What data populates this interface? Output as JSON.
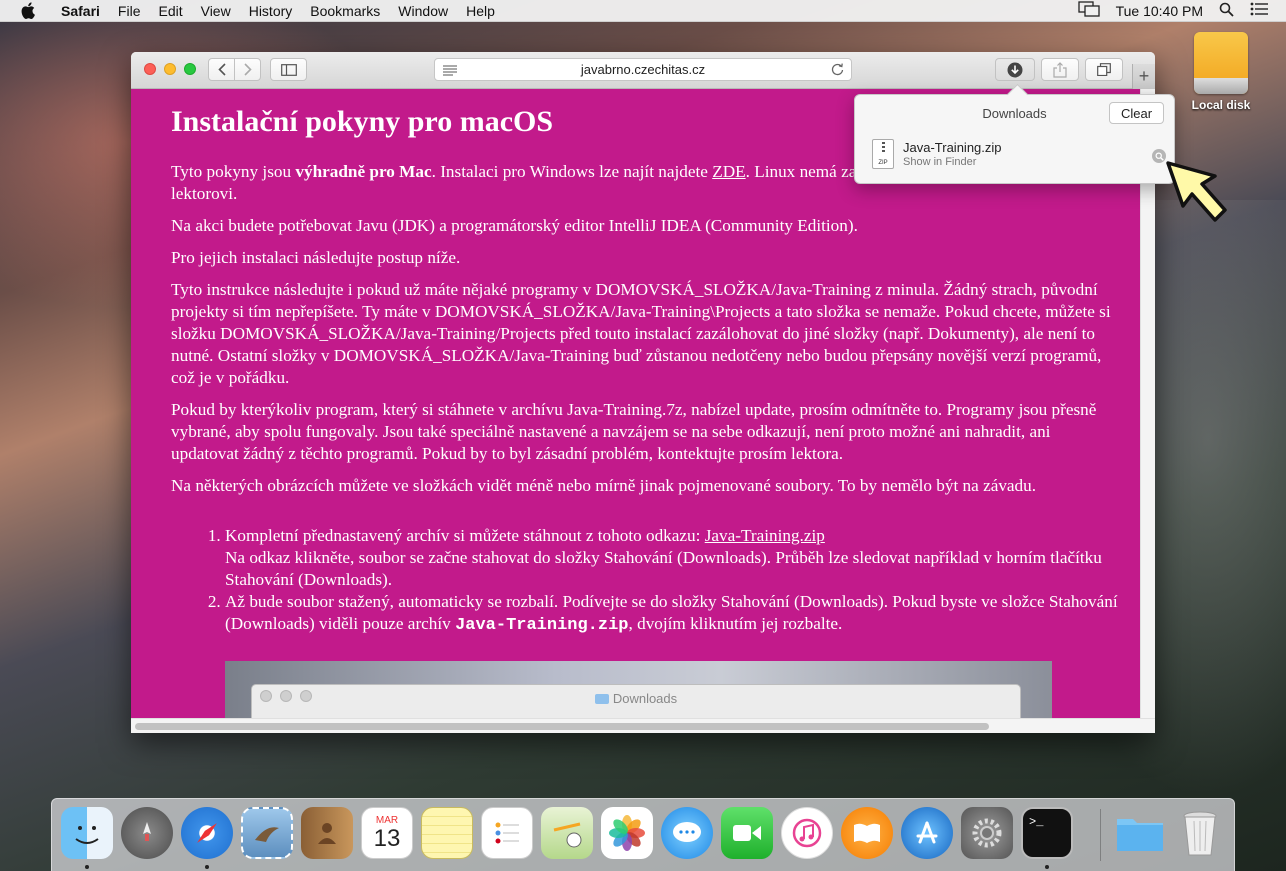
{
  "menubar": {
    "app": "Safari",
    "items": [
      "File",
      "Edit",
      "View",
      "History",
      "Bookmarks",
      "Window",
      "Help"
    ],
    "clock": "Tue 10:40 PM"
  },
  "desktop": {
    "drive_label": "Local disk"
  },
  "browser": {
    "url": "javabrno.czechitas.cz"
  },
  "downloads": {
    "title": "Downloads",
    "clear_label": "Clear",
    "file_name": "Java-Training.zip",
    "file_sub": "Show in Finder",
    "zip_tag": "ZIP"
  },
  "page": {
    "heading": "Instalační pokyny pro macOS",
    "p1_a": "Tyto pokyny jsou ",
    "p1_bold": "výhradně pro Mac",
    "p1_b": ". Instalaci pro Windows lze najít najdete ",
    "p1_link": "ZDE",
    "p1_c": ". Linux nemá zatím pokyny, prosím, ozvěte se lektorovi.",
    "p2": "Na akci budete potřebovat Javu (JDK) a programátorský editor IntelliJ IDEA (Community Edition).",
    "p3": "Pro jejich instalaci následujte postup níže.",
    "p4": "Tyto instrukce následujte i pokud už máte nějaké programy v DOMOVSKÁ_SLOŽKA/Java-Training z minula. Žádný strach, původní projekty si tím nepřepíšete. Ty máte v DOMOVSKÁ_SLOŽKA/Java-Training\\Projects a tato složka se nemaže. Pokud chcete, můžete si složku DOMOVSKÁ_SLOŽKA/Java-Training/Projects před touto instalací zazálohovat do jiné složky (např. Dokumenty), ale není to nutné. Ostatní složky v DOMOVSKÁ_SLOŽKA/Java-Training buď zůstanou nedotčeny nebo budou přepsány novější verzí programů, což je v pořádku.",
    "p5": "Pokud by kterýkoliv program, který si stáhnete v archívu Java-Training.7z, nabízel update, prosím odmítněte to. Programy jsou přesně vybrané, aby spolu fungovaly. Jsou také speciálně nastavené a navzájem se na sebe odkazují, není proto možné ani nahradit, ani updatovat žádný z těchto programů. Pokud by to byl zásadní problém, kontektujte prosím lektora.",
    "p6": "Na některých obrázcích můžete ve složkách vidět méně nebo mírně jinak pojmenované soubory. To by nemělo být na závadu.",
    "li1_a": "Kompletní přednastavený archív si můžete stáhnout z tohoto odkazu: ",
    "li1_link": "Java-Training.zip",
    "li1_b": "Na odkaz klikněte, soubor se začne stahovat do složky Stahování (Downloads). Průběh lze sledovat například v horním tlačítku Stahování (Downloads).",
    "li2_a": "Až bude soubor stažený, automaticky se rozbalí. Podívejte se do složky Stahování (Downloads). Pokud byste ve složce Stahování (Downloads) viděli pouze archív ",
    "li2_code": "Java-Training.zip",
    "li2_b": ", dvojím kliknutím jej rozbalte.",
    "shot_title": "Downloads"
  },
  "dock": {
    "calendar_month": "MAR",
    "calendar_day": "13",
    "terminal_prompt": ">_"
  },
  "colors": {
    "page_bg": "#c21a8b",
    "cursor_fill": "#fff9a8"
  }
}
